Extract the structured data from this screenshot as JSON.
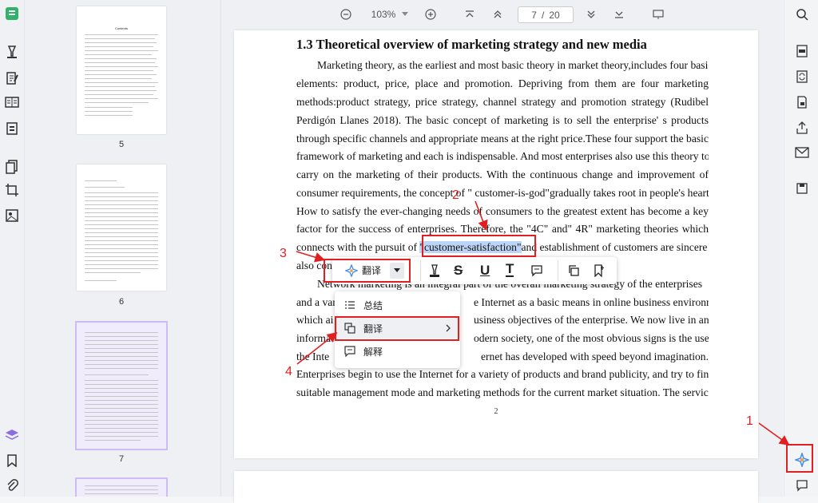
{
  "toolbar": {
    "zoom_level": "103%",
    "current_page": "7",
    "page_separator": "/",
    "total_pages": "20"
  },
  "thumbnails": {
    "pages": [
      {
        "number": "5"
      },
      {
        "number": "6"
      },
      {
        "number": "7"
      }
    ],
    "page5_title": "Contents"
  },
  "document": {
    "heading": "1.3 Theoretical overview of marketing strategy and new media",
    "lines": [
      "Marketing theory, as the earliest and most basic theory in market theory,includes four basic",
      "elements: product, price, place and promotion. Depriving from them are four marketing",
      "methods:product strategy, price strategy, channel strategy and promotion strategy (Rudibel",
      "Perdigón Llanes 2018). The basic concept of marketing is to sell the enterprise' s products",
      "through specific channels and appropriate means at the right price.These four support the basic",
      "framework of marketing and each is indispensable. And most enterprises also use this theory to",
      "carry on the marketing of their products. With the continuous change and improvement of",
      "consumer requirements, the concept of \" customer-is-god\"gradually takes root in people's hearts.",
      "How to satisfy the ever-changing needs of consumers to the greatest extent has become a key",
      "factor for the success of enterprises. Therefore, the \"4C\" and\" 4R\" marketing theories which"
    ],
    "line11_before": "connects with the pursuit of ",
    "highlighted_text": "\"customer-satisfaction\"",
    "line11_after": "and establishment of customers are sincere",
    "line12_start": "also con",
    "line13_start": "Network marketing is an integral part of the overall marketing strategy of the enterprises",
    "line14_start": "and a var",
    "line14_end": "e Internet as a basic means in online business environment,",
    "line15_start": "which ai",
    "line15_end": "usiness objectives of the enterprise. We now live in an",
    "line16_start": "informat",
    "line16_end": "odern society, one of the most obvious signs is the use of",
    "line17_start": "the Inte",
    "line17_end": "ernet has developed with speed beyond imagination.",
    "line18": "Enterprises begin to use the Internet for a variety of products and brand publicity, and try to find",
    "line19": "suitable management mode and marketing methods for the current market situation. The service",
    "page_number": "2"
  },
  "context_toolbar": {
    "translate_label": "翻译"
  },
  "dropdown_menu": {
    "items": [
      {
        "label": "总结",
        "icon": "list-icon"
      },
      {
        "label": "翻译",
        "icon": "translate-icon"
      },
      {
        "label": "解释",
        "icon": "explain-icon"
      }
    ]
  },
  "annotations": {
    "one": "1",
    "two": "2",
    "three": "3",
    "four": "4"
  },
  "colors": {
    "annotation_red": "#e02020",
    "highlight": "#bcd5f7",
    "accent_green": "#2fb36b",
    "selected_thumb": "#f1ecfc"
  }
}
